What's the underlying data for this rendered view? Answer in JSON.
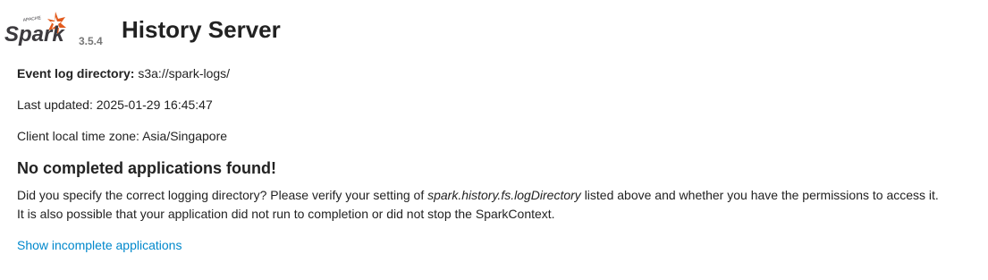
{
  "header": {
    "logo_brand": "Spark",
    "logo_tagline": "APACHE",
    "version": "3.5.4",
    "title": "History Server"
  },
  "info": {
    "event_log_label": "Event log directory:",
    "event_log_value": "s3a://spark-logs/",
    "last_updated_label": "Last updated:",
    "last_updated_value": "2025-01-29 16:45:47",
    "timezone_label": "Client local time zone:",
    "timezone_value": "Asia/Singapore"
  },
  "main": {
    "heading": "No completed applications found!",
    "message_part1": "Did you specify the correct logging directory? Please verify your setting of",
    "message_config": "spark.history.fs.logDirectory",
    "message_part2": "listed above and whether you have the permissions to access it.",
    "message_line2": "It is also possible that your application did not run to completion or did not stop the SparkContext.",
    "incomplete_link": "Show incomplete applications"
  },
  "colors": {
    "logo_orange": "#e25a1c",
    "logo_dark": "#3c3a3e",
    "link": "#0088cc"
  }
}
